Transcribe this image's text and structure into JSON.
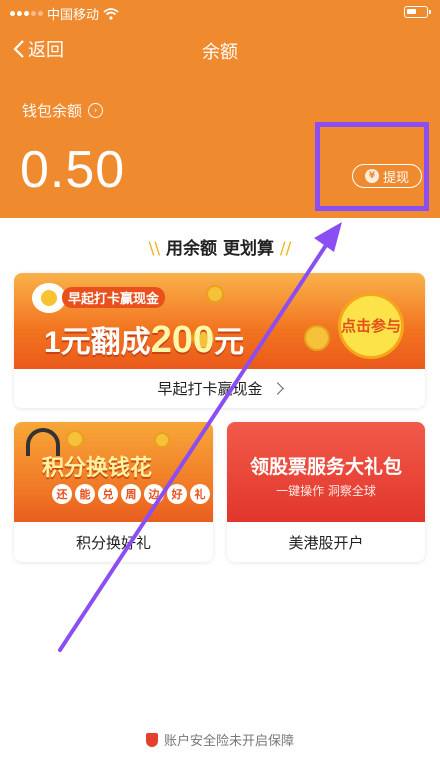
{
  "status_bar": {
    "carrier": "中国移动"
  },
  "nav": {
    "back_label": "返回",
    "title": "余额"
  },
  "wallet": {
    "label": "钱包余额",
    "balance": "0.50",
    "withdraw_label": "提现",
    "withdraw_symbol": "¥"
  },
  "section": {
    "title": "用余额 更划算"
  },
  "cards": {
    "early": {
      "banner_sub": "早起打卡赢现金",
      "banner_main_prefix": "1元翻成",
      "banner_main_number": "200",
      "banner_main_suffix": "元",
      "badge": "点击参与",
      "caption": "早起打卡赢现金"
    },
    "points": {
      "banner_title": "积分换钱花",
      "banner_chars": [
        "还",
        "能",
        "兑",
        "周",
        "边",
        "好",
        "礼"
      ],
      "caption": "积分换好礼"
    },
    "stocks": {
      "banner_title": "领股票服务大礼包",
      "banner_sub": "一键操作 洞察全球",
      "caption": "美港股开户"
    }
  },
  "footer": {
    "text": "账户安全险未开启保障"
  },
  "colors": {
    "header": "#f08a2e",
    "annotation": "#8b4ef2"
  },
  "icons": [
    "wifi-icon",
    "battery-icon",
    "back-chevron-icon",
    "info-icon",
    "yen-icon",
    "chevron-right-icon",
    "shield-icon"
  ]
}
